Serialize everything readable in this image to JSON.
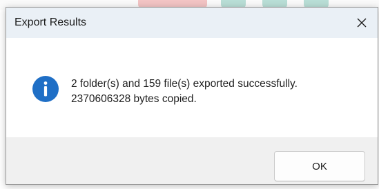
{
  "dialog": {
    "title": "Export Results",
    "close_icon": "close-icon",
    "icon": "info-icon",
    "message_line1": "2 folder(s) and 159 file(s) exported successfully.",
    "message_line2": "2370606328 bytes copied.",
    "ok_label": "OK"
  },
  "colors": {
    "info_icon": "#1f6fc6",
    "titlebar": "#eaf0f6",
    "footer": "#f0f0f0"
  }
}
